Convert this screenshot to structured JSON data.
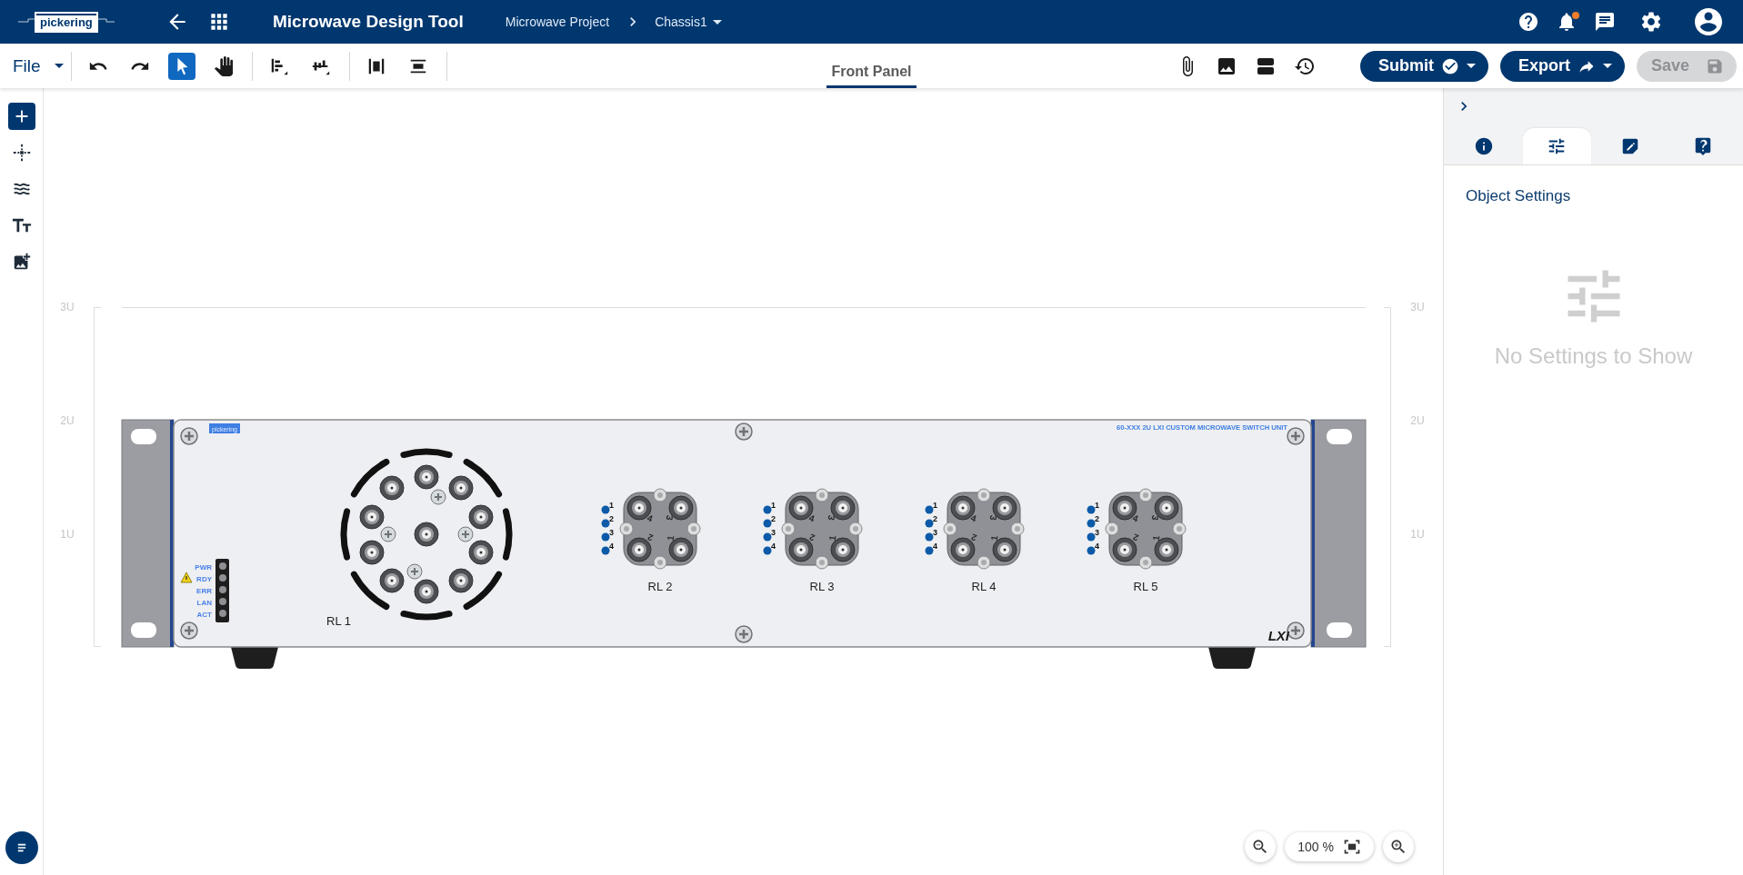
{
  "header": {
    "logo": "pickering",
    "title": "Microwave Design Tool",
    "breadcrumb": [
      {
        "label": "Microwave Project",
        "dropdown": false
      },
      {
        "label": "Chassis1",
        "dropdown": true
      }
    ],
    "notifications_unread": true
  },
  "toolbar": {
    "file_menu": "File",
    "tool_groups": [
      {
        "tools": [
          {
            "kind": "undo",
            "selected": false
          },
          {
            "kind": "redo",
            "selected": false
          },
          {
            "kind": "pointer",
            "selected": true
          },
          {
            "kind": "pan",
            "selected": false
          }
        ]
      },
      {
        "tools": [
          {
            "kind": "align-bottom",
            "selected": false
          },
          {
            "kind": "distribute",
            "selected": false
          }
        ]
      },
      {
        "tools": [
          {
            "kind": "align-edges",
            "selected": false
          },
          {
            "kind": "align-center",
            "selected": false
          }
        ]
      }
    ],
    "view_tabs": [
      {
        "label": "Front Panel",
        "selected": true
      }
    ],
    "actions": [
      {
        "kind": "attach"
      },
      {
        "kind": "image"
      },
      {
        "kind": "layout"
      },
      {
        "kind": "history"
      }
    ],
    "buttons": [
      {
        "kind": "submit",
        "label": "Submit",
        "disabled": false
      },
      {
        "kind": "export",
        "label": "Export",
        "disabled": false
      },
      {
        "kind": "save",
        "label": "Save",
        "disabled": true
      }
    ]
  },
  "left_rail": {
    "tools": [
      {
        "kind": "add",
        "selected": true
      },
      {
        "kind": "crosshair",
        "selected": false
      },
      {
        "kind": "waves",
        "selected": false
      },
      {
        "kind": "text",
        "selected": false
      },
      {
        "kind": "add-image",
        "selected": false
      }
    ],
    "bottom_tool": {
      "kind": "notes"
    }
  },
  "canvas": {
    "rack_units_left": [
      "3U",
      "2U",
      "1U"
    ],
    "rack_units_right": [
      "3U",
      "2U",
      "1U"
    ],
    "chassis": {
      "logo": "pickering",
      "model": "60-XXX 2U LXI CUSTOM MICROWAVE SWITCH UNIT",
      "mark": "LXI",
      "status_indicators": [
        {
          "label": "PWR",
          "warning": false
        },
        {
          "label": "RDY",
          "warning": true
        },
        {
          "label": "ERR",
          "warning": false
        },
        {
          "label": "LAN",
          "warning": false
        },
        {
          "label": "ACT",
          "warning": false
        }
      ],
      "modules": [
        {
          "kind": "multiport",
          "label": "RL 1"
        },
        {
          "kind": "quad",
          "label": "RL 2",
          "channels": [
            "1",
            "2",
            "3",
            "4"
          ],
          "ports": [
            "4",
            "3",
            "2",
            "1"
          ]
        },
        {
          "kind": "quad",
          "label": "RL 3",
          "channels": [
            "1",
            "2",
            "3",
            "4"
          ],
          "ports": [
            "4",
            "3",
            "2",
            "1"
          ]
        },
        {
          "kind": "quad",
          "label": "RL 4",
          "channels": [
            "1",
            "2",
            "3",
            "4"
          ],
          "ports": [
            "4",
            "3",
            "2",
            "1"
          ]
        },
        {
          "kind": "quad",
          "label": "RL 5",
          "channels": [
            "1",
            "2",
            "3",
            "4"
          ],
          "ports": [
            "4",
            "3",
            "2",
            "1"
          ]
        }
      ]
    },
    "zoom": {
      "reading": "100 %"
    }
  },
  "side_panel": {
    "tabs": [
      {
        "kind": "info",
        "selected": false
      },
      {
        "kind": "settings",
        "selected": true
      },
      {
        "kind": "notes",
        "selected": false
      },
      {
        "kind": "help",
        "selected": false
      }
    ],
    "heading": "Object Settings",
    "empty_message": "No Settings to Show"
  }
}
